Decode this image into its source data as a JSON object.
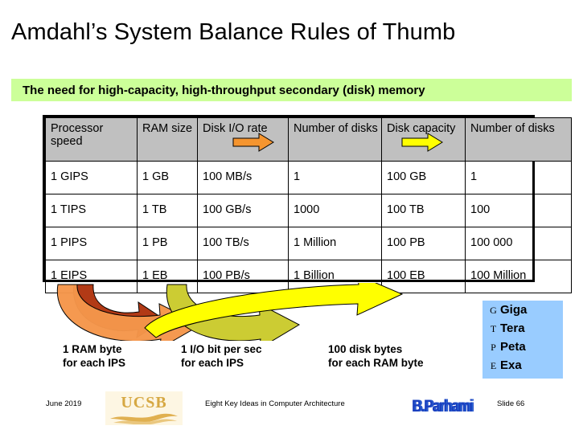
{
  "slide": {
    "title": "Amdahl’s System Balance Rules of Thumb",
    "banner": "The need for high-capacity, high-throughput secondary (disk) memory"
  },
  "table": {
    "headers": [
      "Processor speed",
      "RAM size",
      "Disk I/O rate",
      "Number of disks",
      "Disk capacity",
      "Number of disks"
    ],
    "rows": [
      [
        "1 GIPS",
        "1 GB",
        "100 MB/s",
        "1",
        "100 GB",
        "1"
      ],
      [
        "1 TIPS",
        "1 TB",
        "100 GB/s",
        "1000",
        "100 TB",
        "100"
      ],
      [
        "1 PIPS",
        "1 PB",
        "100 TB/s",
        "1 Million",
        "100 PB",
        "100 000"
      ],
      [
        "1 EIPS",
        "1 EB",
        "100 PB/s",
        "1 Billion",
        "100 EB",
        "100 Million"
      ]
    ],
    "header_bg": "#C0C0C0"
  },
  "header_arrows": [
    {
      "name": "orange-arrow",
      "color": "#F5952F"
    },
    {
      "name": "yellow-arrow",
      "color": "#FFFF00"
    }
  ],
  "curved_arrows": [
    {
      "name": "dark-red-curve",
      "color": "#B23A16"
    },
    {
      "name": "olive-curve",
      "color": "#CCCC33"
    },
    {
      "name": "orange-curve",
      "color": "#F5964B"
    },
    {
      "name": "yellow-curve",
      "color": "#FFFF00"
    }
  ],
  "captions": [
    {
      "line1": "1 RAM byte",
      "line2": "for each IPS"
    },
    {
      "line1": "1 I/O bit per sec",
      "line2": "for each IPS"
    },
    {
      "line1": "100 disk bytes",
      "line2": "for each RAM byte"
    }
  ],
  "legend": {
    "bg": "#99CCFF",
    "items": [
      {
        "symbol": "G",
        "word": "Giga"
      },
      {
        "symbol": "T",
        "word": "Tera"
      },
      {
        "symbol": "P",
        "word": "Peta"
      },
      {
        "symbol": "E",
        "word": "Exa"
      }
    ]
  },
  "footer": {
    "date": "June 2019",
    "university_logo": "UCSB",
    "center_text": "Eight Key Ideas in Computer Architecture",
    "author_logo": "B.Parhami",
    "slide_number": "Slide 66"
  }
}
